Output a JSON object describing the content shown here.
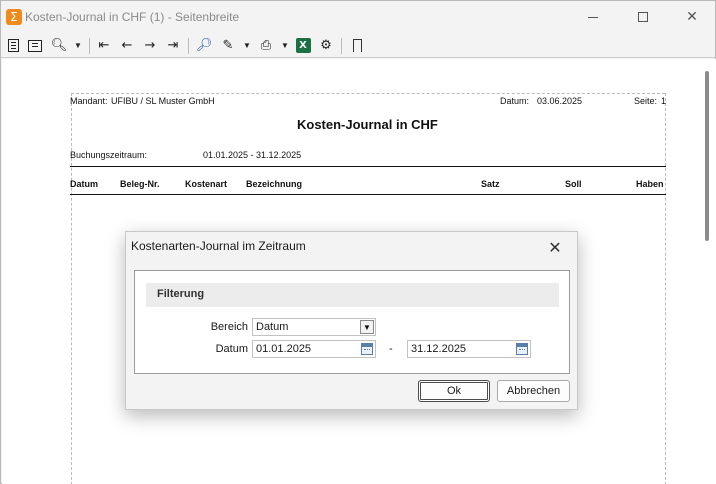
{
  "window": {
    "title": "Kosten-Journal in CHF (1) - Seitenbreite",
    "app_icon_glyph": "Σ",
    "controls": [
      "minimize-icon",
      "maximize-icon",
      "close-icon"
    ]
  },
  "toolbar": {
    "icons": [
      "single-page-icon",
      "page-width-icon",
      "zoom-icon",
      "first-page-icon",
      "previous-page-icon",
      "next-page-icon",
      "last-page-icon",
      "search-icon",
      "edit-icon",
      "print-icon",
      "excel-export-icon",
      "settings-icon",
      "exit-icon"
    ]
  },
  "report": {
    "mandant_label": "Mandant:",
    "mandant_value": "UFIBU / SL Muster GmbH",
    "datum_label": "Datum:",
    "datum_value": "03.06.2025",
    "seite_label": "Seite:",
    "seite_value": "1",
    "title": "Kosten-Journal in CHF",
    "zeitraum_label": "Buchungszeitraum:",
    "zeitraum_value": "01.01.2025 - 31.12.2025",
    "columns": {
      "datum": "Datum",
      "beleg": "Beleg-Nr.",
      "kostenart": "Kostenart",
      "bezeichnung": "Bezeichnung",
      "satz": "Satz",
      "soll": "Soll",
      "haben": "Haben"
    }
  },
  "dialog": {
    "title": "Kostenarten-Journal im Zeitraum",
    "group_title": "Filterung",
    "bereich_label": "Bereich",
    "bereich_value": "Datum",
    "datum_label": "Datum",
    "datum_from": "01.01.2025",
    "datum_separator": "-",
    "datum_to": "31.12.2025",
    "ok_label": "Ok",
    "cancel_label": "Abbrechen"
  }
}
